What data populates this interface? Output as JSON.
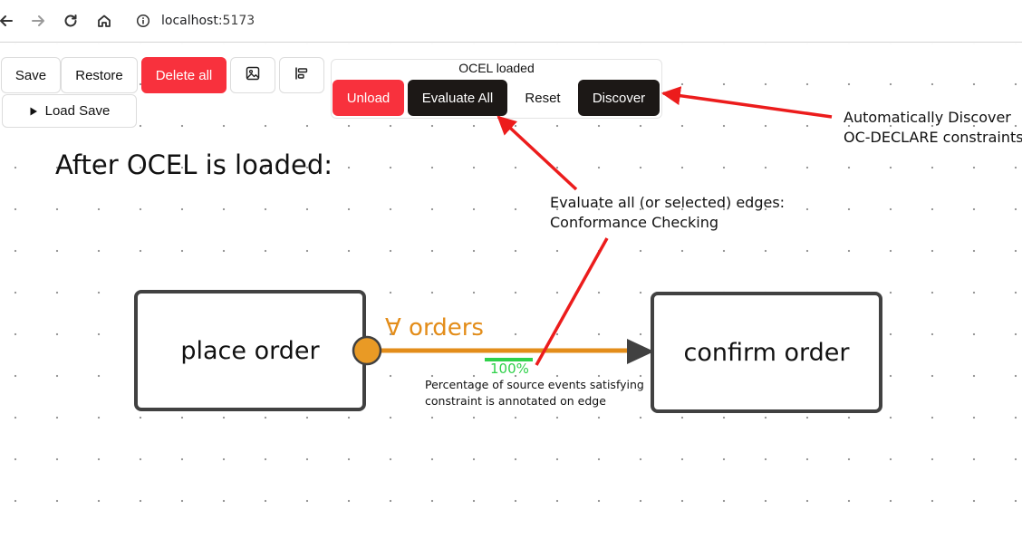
{
  "browser": {
    "url_host": "localhost",
    "url_port": ":5173"
  },
  "toolbar": {
    "save_label": "Save",
    "restore_label": "Restore",
    "delete_all_label": "Delete all",
    "load_save_label": "Load Save",
    "image_icon": "image-icon",
    "align_icon": "align-left-icon"
  },
  "ocel_panel": {
    "title": "OCEL loaded",
    "unload_label": "Unload",
    "evaluate_all_label": "Evaluate All",
    "reset_label": "Reset",
    "discover_label": "Discover"
  },
  "heading": "After OCEL is loaded:",
  "nodes": {
    "source": "place order",
    "target": "confirm order"
  },
  "edge": {
    "label": "∀ orders",
    "percentage": "100%",
    "color": "#e38d1a",
    "pct_color": "#2fd14a"
  },
  "annotations": {
    "discover_line1": "Automatically Discover",
    "discover_line2": "OC-DECLARE constraints",
    "evaluate_line1": "Evaluate all (or selected) edges:",
    "evaluate_line2": "Conformance Checking",
    "percent_line1": "Percentage of source events satisfying",
    "percent_line2": "constraint is annotated on edge",
    "arrow_color": "#ec1c1c"
  }
}
